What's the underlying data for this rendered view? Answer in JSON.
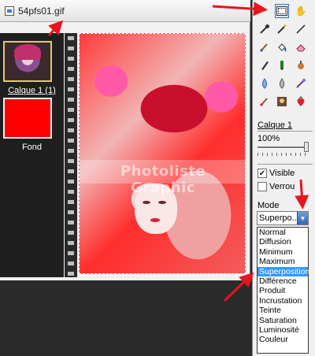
{
  "document": {
    "title": "54pfs01.gif",
    "watermark": "Photoliste Graphic"
  },
  "layers": [
    {
      "name": "Calque 1 (1)",
      "selected": true
    },
    {
      "name": "Fond",
      "selected": false,
      "color": "#ff0000"
    }
  ],
  "tools": {
    "items": [
      "select-layer-icon",
      "hand-icon",
      "eyedropper-icon",
      "magic-wand-icon",
      "line-icon",
      "brush-icon",
      "fill-icon",
      "eraser-icon",
      "pen-icon",
      "marker-icon",
      "smudge-icon",
      "stamp-icon",
      "drop-icon",
      "tint-icon",
      "burn-icon",
      "brush2-icon",
      "portrait-icon",
      "red-eye-icon",
      "strawberry-icon"
    ],
    "selected": "select-layer-icon"
  },
  "layer_properties": {
    "layer_name": "Calque 1",
    "opacity_label": "100%",
    "opacity_value": 1.0,
    "visible_label": "Visible",
    "visible_checked": true,
    "lock_label": "Verrou",
    "lock_checked": false,
    "mode_label": "Mode",
    "mode_value": "Superpo...",
    "mode_options": [
      "Normal",
      "Diffusion",
      "Minimum",
      "Maximum",
      "Superposition",
      "Différence",
      "Produit",
      "Incrustation",
      "Teinte",
      "Saturation",
      "Luminosité",
      "Couleur"
    ],
    "mode_highlighted": "Superposition"
  },
  "colors": {
    "accent": "#3399ff",
    "arrow": "#e8141e",
    "layer_fond": "#ff0000"
  }
}
